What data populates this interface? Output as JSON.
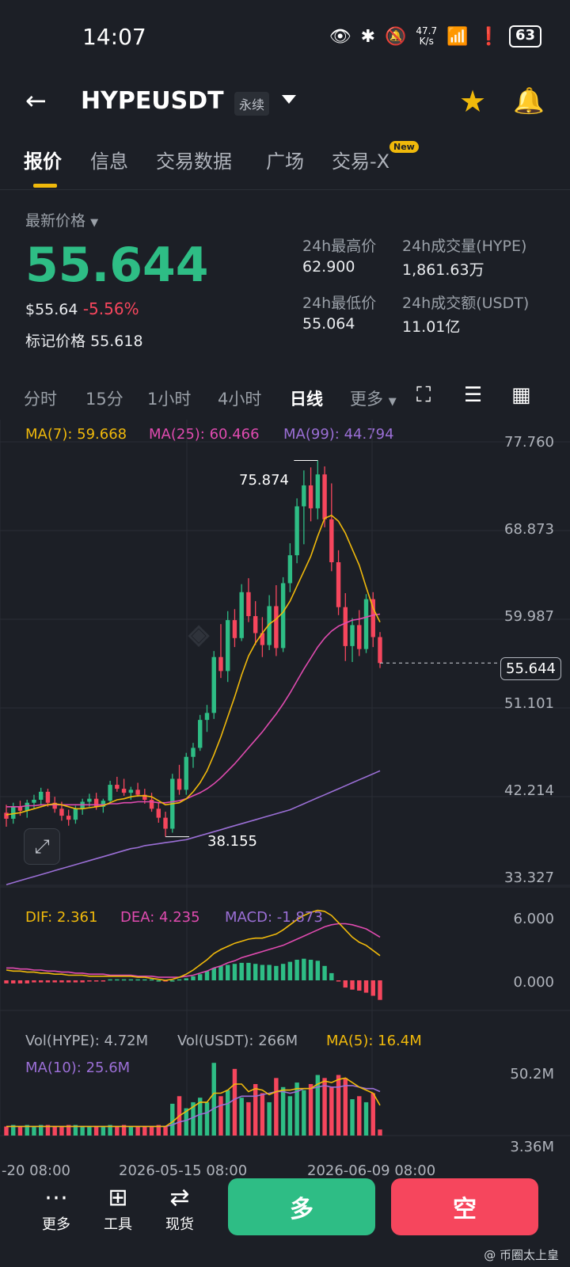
{
  "status_bar": {
    "time": "14:07",
    "netspeed_value": "47.7",
    "netspeed_unit": "K/s",
    "battery": "63"
  },
  "header": {
    "symbol": "HYPEUSDT",
    "contract_type": "永续"
  },
  "tabs": [
    {
      "label": "报价",
      "active": true
    },
    {
      "label": "信息"
    },
    {
      "label": "交易数据"
    },
    {
      "label": "广场"
    },
    {
      "label": "交易-X",
      "badge": "New"
    }
  ],
  "price": {
    "latest_label": "最新价格",
    "last": "55.644",
    "usd": "$55.64",
    "change": "-5.56%",
    "mark_label": "标记价格",
    "mark": "55.618",
    "high_label": "24h最高价",
    "high": "62.900",
    "low_label": "24h最低价",
    "low": "55.064",
    "vol_label": "24h成交量(HYPE)",
    "vol": "1,861.63万",
    "turnover_label": "24h成交额(USDT)",
    "turnover": "11.01亿"
  },
  "intervals": [
    "分时",
    "15分",
    "1小时",
    "4小时",
    "日线",
    "更多"
  ],
  "active_interval": "日线",
  "colors": {
    "up": "#2ebd85",
    "down": "#f6465d",
    "ma7": "#f0b90b",
    "ma25": "#e04bb0",
    "ma99": "#9b6fd6",
    "bg": "#1c1f26"
  },
  "ma_legend": {
    "ma7": "MA(7): 59.668",
    "ma25": "MA(25): 60.466",
    "ma99": "MA(99): 44.794"
  },
  "macd_legend": {
    "dif": "DIF: 2.361",
    "dea": "DEA: 4.235",
    "macd": "MACD: -1.873"
  },
  "vol_legend": {
    "vol_hype": "Vol(HYPE): 4.72M",
    "vol_usdt": "Vol(USDT): 266M",
    "ma5": "MA(5): 16.4M",
    "ma10": "MA(10): 25.6M"
  },
  "chart_data": {
    "type": "candlestick",
    "price_axis_ticks": [
      "77.760",
      "68.873",
      "59.987",
      "51.101",
      "42.214",
      "33.327"
    ],
    "price_axis_range": [
      33.327,
      77.76
    ],
    "high_marker": "75.874",
    "low_marker": "38.155",
    "current_price_tag": "55.644",
    "macd_axis_ticks": [
      "6.000",
      "0.000"
    ],
    "volume_axis_ticks": [
      "50.2M",
      "3.36M"
    ],
    "x_axis_labels": [
      "-20 08:00",
      "2026-05-15 08:00",
      "2026-06-09 08:00"
    ],
    "candles": [
      [
        40.6,
        41.4,
        39.2,
        40.0
      ],
      [
        40.0,
        41.6,
        39.5,
        41.2
      ],
      [
        41.2,
        41.8,
        40.3,
        40.8
      ],
      [
        40.8,
        41.9,
        40.1,
        41.6
      ],
      [
        41.6,
        42.4,
        41.0,
        41.9
      ],
      [
        41.9,
        43.1,
        41.3,
        42.7
      ],
      [
        42.7,
        43.0,
        41.2,
        41.6
      ],
      [
        41.6,
        42.2,
        40.6,
        41.0
      ],
      [
        41.0,
        41.7,
        39.8,
        40.3
      ],
      [
        40.3,
        40.9,
        39.3,
        39.9
      ],
      [
        39.9,
        41.3,
        39.5,
        41.0
      ],
      [
        41.0,
        42.0,
        40.4,
        41.7
      ],
      [
        41.7,
        42.5,
        41.2,
        42.0
      ],
      [
        42.0,
        42.6,
        40.9,
        41.2
      ],
      [
        41.2,
        42.0,
        40.6,
        41.8
      ],
      [
        41.8,
        43.8,
        41.5,
        43.4
      ],
      [
        43.4,
        44.2,
        42.7,
        43.0
      ],
      [
        43.0,
        44.0,
        42.3,
        42.6
      ],
      [
        42.6,
        43.2,
        41.9,
        42.9
      ],
      [
        42.9,
        43.6,
        42.2,
        42.4
      ],
      [
        42.4,
        43.0,
        41.5,
        41.9
      ],
      [
        41.9,
        42.6,
        40.7,
        41.0
      ],
      [
        41.0,
        41.6,
        39.6,
        40.1
      ],
      [
        40.1,
        40.7,
        38.2,
        39.0
      ],
      [
        39.0,
        44.5,
        38.6,
        44.0
      ],
      [
        44.0,
        45.4,
        42.4,
        42.9
      ],
      [
        42.9,
        46.6,
        42.4,
        46.2
      ],
      [
        46.2,
        47.6,
        45.1,
        47.1
      ],
      [
        47.1,
        50.4,
        46.8,
        49.9
      ],
      [
        49.9,
        51.4,
        48.7,
        50.6
      ],
      [
        50.6,
        56.8,
        50.0,
        56.2
      ],
      [
        56.2,
        59.5,
        54.1,
        54.8
      ],
      [
        54.8,
        60.8,
        53.7,
        59.9
      ],
      [
        59.9,
        61.0,
        57.2,
        58.1
      ],
      [
        58.1,
        63.5,
        57.8,
        62.7
      ],
      [
        62.7,
        64.1,
        59.7,
        60.3
      ],
      [
        60.3,
        61.8,
        57.4,
        58.6
      ],
      [
        58.6,
        60.2,
        56.2,
        57.4
      ],
      [
        57.4,
        62.4,
        56.9,
        61.3
      ],
      [
        61.3,
        63.4,
        56.3,
        57.1
      ],
      [
        57.1,
        64.2,
        56.7,
        63.6
      ],
      [
        63.6,
        67.6,
        62.7,
        66.4
      ],
      [
        66.4,
        72.1,
        65.6,
        71.3
      ],
      [
        71.3,
        74.9,
        67.5,
        73.4
      ],
      [
        73.4,
        75.2,
        69.8,
        71.1
      ],
      [
        71.1,
        75.9,
        70.0,
        74.5
      ],
      [
        74.5,
        75.3,
        69.2,
        70.0
      ],
      [
        70.0,
        73.6,
        64.8,
        65.7
      ],
      [
        65.7,
        66.9,
        60.4,
        61.2
      ],
      [
        61.2,
        62.6,
        55.8,
        57.3
      ],
      [
        57.3,
        60.1,
        55.7,
        59.4
      ],
      [
        59.4,
        60.9,
        56.3,
        57.0
      ],
      [
        57.0,
        62.5,
        56.6,
        62.0
      ],
      [
        62.0,
        62.7,
        57.2,
        58.2
      ],
      [
        58.2,
        58.7,
        55.1,
        55.6
      ]
    ],
    "ma7": [
      40.4,
      40.5,
      40.6,
      40.8,
      41.0,
      41.2,
      41.4,
      41.5,
      41.4,
      41.2,
      41.0,
      41.0,
      41.1,
      41.2,
      41.3,
      41.6,
      41.9,
      42.0,
      42.2,
      42.3,
      42.3,
      42.2,
      41.8,
      41.4,
      41.5,
      41.6,
      42.0,
      42.7,
      43.6,
      44.8,
      46.4,
      48.2,
      50.2,
      52.2,
      54.4,
      56.3,
      57.6,
      58.6,
      59.5,
      60.0,
      60.7,
      61.8,
      63.3,
      64.8,
      66.3,
      68.3,
      70.1,
      70.4,
      69.8,
      68.6,
      67.0,
      65.4,
      63.2,
      61.1,
      59.7
    ],
    "ma25": [
      41.2,
      41.2,
      41.2,
      41.3,
      41.3,
      41.4,
      41.4,
      41.4,
      41.4,
      41.4,
      41.4,
      41.4,
      41.4,
      41.4,
      41.4,
      41.5,
      41.5,
      41.6,
      41.6,
      41.7,
      41.7,
      41.7,
      41.6,
      41.6,
      41.7,
      41.8,
      42.0,
      42.3,
      42.6,
      43.0,
      43.5,
      44.1,
      44.8,
      45.5,
      46.3,
      47.1,
      47.9,
      48.7,
      49.6,
      50.5,
      51.5,
      52.6,
      53.8,
      55.0,
      56.1,
      57.2,
      58.1,
      58.8,
      59.3,
      59.6,
      59.9,
      60.0,
      60.2,
      60.4,
      60.5
    ],
    "ma99": [
      33.4,
      33.6,
      33.8,
      34.0,
      34.2,
      34.4,
      34.6,
      34.8,
      35.0,
      35.2,
      35.4,
      35.6,
      35.8,
      36.0,
      36.2,
      36.4,
      36.6,
      36.8,
      37.0,
      37.1,
      37.3,
      37.4,
      37.5,
      37.6,
      37.7,
      37.8,
      37.9,
      38.1,
      38.3,
      38.5,
      38.7,
      38.9,
      39.1,
      39.3,
      39.5,
      39.7,
      39.9,
      40.1,
      40.3,
      40.5,
      40.7,
      40.9,
      41.2,
      41.5,
      41.8,
      42.1,
      42.4,
      42.7,
      43.0,
      43.3,
      43.6,
      43.9,
      44.2,
      44.5,
      44.8
    ],
    "macd": [
      -0.3,
      -0.3,
      -0.3,
      -0.3,
      -0.2,
      -0.2,
      -0.2,
      -0.2,
      -0.2,
      -0.2,
      -0.2,
      -0.2,
      -0.1,
      -0.1,
      -0.1,
      0.1,
      0.1,
      0.1,
      0.1,
      0.1,
      0.1,
      0.1,
      0.0,
      -0.1,
      0.0,
      0.1,
      0.2,
      0.4,
      0.6,
      0.9,
      1.2,
      1.4,
      1.5,
      1.6,
      1.7,
      1.7,
      1.6,
      1.5,
      1.5,
      1.4,
      1.6,
      1.8,
      2.0,
      2.1,
      2.0,
      1.9,
      1.4,
      0.7,
      -0.1,
      -0.7,
      -0.9,
      -1.0,
      -1.2,
      -1.5,
      -1.9
    ],
    "dif": [
      1.0,
      0.9,
      0.9,
      0.8,
      0.8,
      0.7,
      0.7,
      0.6,
      0.6,
      0.5,
      0.5,
      0.5,
      0.4,
      0.4,
      0.4,
      0.4,
      0.4,
      0.4,
      0.4,
      0.3,
      0.3,
      0.2,
      0.1,
      0.0,
      0.1,
      0.3,
      0.6,
      1.0,
      1.5,
      2.0,
      2.6,
      3.0,
      3.3,
      3.6,
      3.8,
      4.0,
      4.1,
      4.1,
      4.3,
      4.5,
      4.9,
      5.4,
      5.9,
      6.3,
      6.6,
      6.8,
      6.7,
      6.3,
      5.6,
      4.9,
      4.2,
      3.7,
      3.4,
      2.9,
      2.4
    ],
    "dea": [
      1.2,
      1.2,
      1.1,
      1.1,
      1.0,
      1.0,
      0.9,
      0.9,
      0.8,
      0.8,
      0.7,
      0.7,
      0.6,
      0.6,
      0.6,
      0.5,
      0.5,
      0.5,
      0.5,
      0.4,
      0.4,
      0.4,
      0.3,
      0.3,
      0.3,
      0.3,
      0.4,
      0.5,
      0.7,
      0.9,
      1.2,
      1.4,
      1.7,
      1.9,
      2.2,
      2.4,
      2.6,
      2.8,
      3.0,
      3.2,
      3.4,
      3.7,
      4.0,
      4.3,
      4.6,
      4.9,
      5.2,
      5.4,
      5.5,
      5.5,
      5.4,
      5.2,
      5.0,
      4.6,
      4.2
    ],
    "volume": [
      6,
      7,
      6,
      7,
      6,
      7,
      7,
      6,
      6,
      7,
      7,
      6,
      6,
      6,
      6,
      7,
      6,
      7,
      6,
      6,
      6,
      6,
      7,
      6,
      21,
      26,
      18,
      22,
      25,
      22,
      48,
      26,
      30,
      44,
      25,
      22,
      34,
      28,
      22,
      38,
      32,
      26,
      35,
      30,
      34,
      40,
      38,
      32,
      40,
      38,
      24,
      26,
      22,
      28,
      4
    ],
    "vol_ma5": [
      6,
      6,
      6,
      6,
      6,
      6,
      6,
      6,
      6,
      6,
      6,
      6,
      6,
      6,
      6,
      6,
      6,
      6,
      6,
      6,
      6,
      6,
      6,
      6,
      9,
      13,
      16,
      19,
      22,
      22,
      28,
      28,
      30,
      34,
      34,
      29,
      31,
      30,
      27,
      29,
      30,
      30,
      31,
      31,
      31,
      34,
      36,
      35,
      37,
      38,
      35,
      32,
      30,
      28,
      20
    ],
    "vol_ma10": [
      6,
      6,
      6,
      6,
      6,
      6,
      6,
      6,
      6,
      6,
      6,
      6,
      6,
      6,
      6,
      6,
      6,
      6,
      6,
      6,
      6,
      6,
      6,
      6,
      7,
      9,
      10,
      12,
      14,
      15,
      18,
      20,
      21,
      24,
      26,
      26,
      26,
      27,
      28,
      29,
      29,
      28,
      29,
      31,
      31,
      32,
      33,
      32,
      32,
      33,
      33,
      32,
      31,
      31,
      29
    ]
  },
  "bottom_bar": {
    "more": "更多",
    "tools": "工具",
    "spot": "现货",
    "long": "多",
    "short": "空"
  },
  "watermark": "@ 币圈太上皇"
}
